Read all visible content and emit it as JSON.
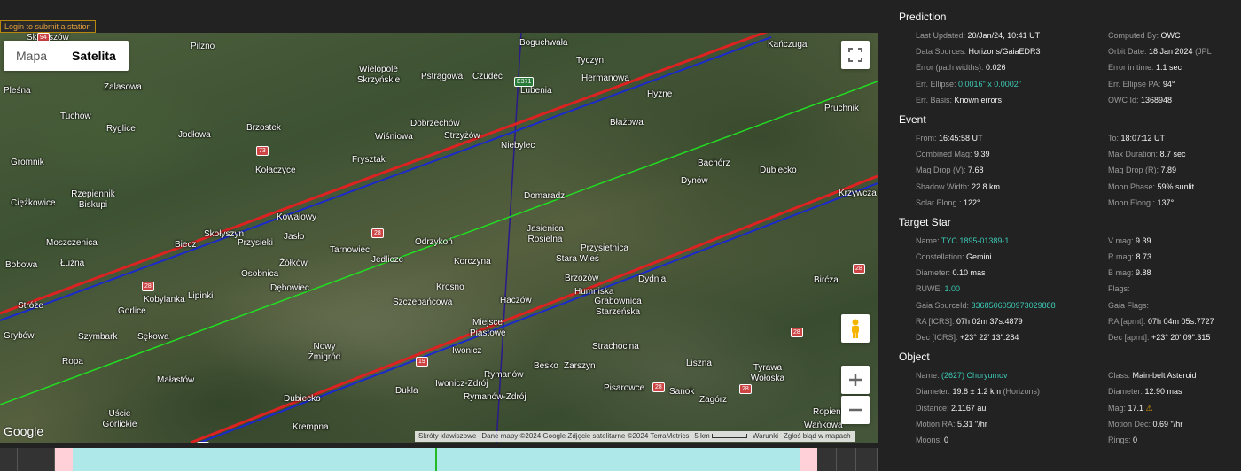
{
  "login_bar": "Login to submit a station",
  "map": {
    "maptype": {
      "map_label": "Mapa",
      "satellite_label": "Satelita",
      "active": "satellite"
    },
    "google_logo": "Google",
    "attribution": [
      "Skróty klawiszowe",
      "Dane mapy ©2024 Google Zdjęcie satelitarne ©2024 TerraMetrics",
      "5 km",
      "Warunki",
      "Zgłoś błąd w mapach"
    ],
    "places": [
      "Skrzyszów",
      "Pilzno",
      "Wielopole Skrzyńskie",
      "Pstrągowa",
      "Czudec",
      "Boguchwała",
      "Tyczyn",
      "Kańczuga",
      "Lubenia",
      "Hermanowa",
      "Hyżne",
      "Pruchnik",
      "Pleśna",
      "Zalasowa",
      "Tuchów",
      "Ryglice",
      "Jodłowa",
      "Brzostek",
      "Wiśniowa",
      "Dobrzechów",
      "Strzyżów",
      "Niebylec",
      "Błażowa",
      "Gromnik",
      "Frysztak",
      "Bachórz",
      "Dubiecko",
      "Dynów",
      "Kołaczyce",
      "Rzepiennik Biskupi",
      "Ciężkowice",
      "Kowalowy",
      "Domaradz",
      "Krzywcza",
      "Skołyszyn",
      "Jasło",
      "Przysieki",
      "Tarnowiec",
      "Odrzykoń",
      "Jasienica Rosielna",
      "Moszczenica",
      "Biecz",
      "Jedlicze",
      "Korczyna",
      "Przysietnica",
      "Stara Wieś",
      "Bobowa",
      "Łużna",
      "Żółków",
      "Osobnica",
      "Krosno",
      "Brzozów",
      "Dydnia",
      "Humniska",
      "Grabownica Starzeńska",
      "Birćza",
      "Kobylanka",
      "Lipinki",
      "Dębowiec",
      "Szczepańcowa",
      "Haczów",
      "Stróże",
      "Gorlice",
      "Grybów",
      "Szymbark",
      "Sękowa",
      "Miejsce Piastowe",
      "Iwonicz",
      "Strachocina",
      "Ropa",
      "Nowy Żmigród",
      "Besko",
      "Zarszyn",
      "Liszna",
      "Tyrawa Wołoska",
      "Małastów",
      "Rymanów",
      "Iwonicz-Zdrój",
      "Rymanów-Zdrój",
      "Pisarowce",
      "Sanok",
      "Uście Gorlickie",
      "Dukla",
      "Krempna",
      "Zagórz",
      "Ropienka",
      "Wańkowa",
      "Dubiecko"
    ],
    "roads": [
      "94",
      "73",
      "28",
      "28",
      "28",
      "19",
      "28",
      "28",
      "28",
      "28",
      "E371"
    ]
  },
  "panel": {
    "sections": [
      {
        "title": "Prediction",
        "rows": [
          [
            {
              "label": "Last Updated: ",
              "value": "20/Jan/24, 10:41 UT"
            },
            {
              "label": "Computed By: ",
              "value": "OWC"
            }
          ],
          [
            {
              "label": "Data Sources: ",
              "value": "Horizons/GaiaEDR3"
            },
            {
              "label": "Orbit Date: ",
              "value": "18 Jan 2024",
              "extra": " (JPL"
            }
          ],
          [
            {
              "label": "Error (path widths): ",
              "value": "0.026"
            },
            {
              "label": "Error in time: ",
              "value": "1.1 sec"
            }
          ],
          [
            {
              "label": "Err. Ellipse: ",
              "value": "0.0016\" x 0.0002\"",
              "link": true
            },
            {
              "label": "Err. Ellipse PA: ",
              "value": "94°"
            }
          ],
          [
            {
              "label": "Err. Basis: ",
              "value": "Known errors"
            },
            {
              "label": "OWC Id: ",
              "value": "1368948"
            }
          ]
        ]
      },
      {
        "title": "Event",
        "rows": [
          [
            {
              "label": "From: ",
              "value": "16:45:58 UT"
            },
            {
              "label": "To: ",
              "value": "18:07:12 UT"
            }
          ],
          [
            {
              "label": "Combined Mag: ",
              "value": "9.39"
            },
            {
              "label": "Max Duration: ",
              "value": "8.7 sec"
            }
          ],
          [
            {
              "label": "Mag Drop (V): ",
              "value": "7.68"
            },
            {
              "label": "Mag Drop (R): ",
              "value": "7.89"
            }
          ],
          [
            {
              "label": "Shadow Width: ",
              "value": "22.8 km"
            },
            {
              "label": "Moon Phase: ",
              "value": "59% sunlit"
            }
          ],
          [
            {
              "label": "Solar Elong.: ",
              "value": "122°"
            },
            {
              "label": "Moon Elong.: ",
              "value": "137°"
            }
          ]
        ]
      },
      {
        "title": "Target Star",
        "rows": [
          [
            {
              "label": "Name: ",
              "value": "TYC 1895-01389-1",
              "link": true
            },
            {
              "label": "V mag: ",
              "value": "9.39"
            }
          ],
          [
            {
              "label": "Constellation: ",
              "value": "Gemini"
            },
            {
              "label": "R mag: ",
              "value": "8.73"
            }
          ],
          [
            {
              "label": "Diameter: ",
              "value": "0.10 mas"
            },
            {
              "label": "B mag: ",
              "value": "9.88"
            }
          ],
          [
            {
              "label": "RUWE: ",
              "value": "1.00",
              "link": true
            },
            {
              "label": "Flags: ",
              "value": ""
            }
          ],
          [
            {
              "label": "Gaia SourceId: ",
              "value": "3368506050973029888",
              "link": true
            },
            {
              "label": "Gaia Flags: ",
              "value": ""
            }
          ],
          [
            {
              "label": "RA [ICRS]: ",
              "value": "07h 02m 37s.4879"
            },
            {
              "label": "RA [aprnt]: ",
              "value": "07h 04m 05s.7727"
            }
          ],
          [
            {
              "label": "Dec [ICRS]: ",
              "value": "+23° 22' 13\".284"
            },
            {
              "label": "Dec [aprnt]: ",
              "value": "+23° 20' 09\".315"
            }
          ]
        ]
      },
      {
        "title": "Object",
        "rows": [
          [
            {
              "label": "Name: ",
              "value": "(2627) Churyumov",
              "link": true
            },
            {
              "label": "Class: ",
              "value": "Main-belt Asteroid"
            }
          ],
          [
            {
              "label": "Diameter: ",
              "value": "19.8 ± 1.2 km",
              "extra": " (Horizons)"
            },
            {
              "label": "Diameter: ",
              "value": "12.90 mas"
            }
          ],
          [
            {
              "label": "Distance: ",
              "value": "2.1167 au"
            },
            {
              "label": "Mag: ",
              "value": "17.1",
              "warn": true
            }
          ],
          [
            {
              "label": "Motion RA: ",
              "value": "5.31 \"/hr"
            },
            {
              "label": "Motion Dec: ",
              "value": "0.69 \"/hr"
            }
          ],
          [
            {
              "label": "Moons: ",
              "value": "0"
            },
            {
              "label": "Rings: ",
              "value": "0"
            }
          ]
        ]
      }
    ]
  },
  "colors": {
    "center_line": "#22dd22",
    "limit_line": "#1a2acc",
    "error_band": "#dd2222",
    "track_line": "#2a1a8a",
    "link": "#3cc8b4",
    "timeline": "#aee8e8",
    "timeline_edge": "#ffd0d8"
  }
}
